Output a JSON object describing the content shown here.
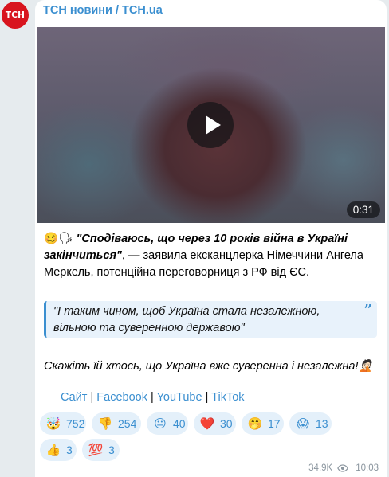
{
  "channel": {
    "avatar_text": "ТСН",
    "name": "ТСН новини / TCH.ua"
  },
  "video": {
    "duration": "0:31",
    "play_icon": "play-icon"
  },
  "post": {
    "lead_emojis": "🥴🗣",
    "quote_headline": "\"Сподіваюсь, що через 10 років війна в Україні закінчиться\"",
    "lead_rest": ", — заявила ексканцлерка Німеччини Ангела Меркель, потенційна переговорниця з РФ від ЄС.",
    "blockquote": "\"І таким чином, щоб Україна стала незалежною, вільною та суверенною державою\"",
    "closing": "Скажіть їй хтось, що Україна вже суверенна і незалежна!",
    "closing_emoji": "🤦🏻"
  },
  "links": {
    "site": "Сайт",
    "facebook": "Facebook",
    "youtube": "YouTube",
    "tiktok": "TikTok",
    "separator": "|"
  },
  "reactions": [
    {
      "emoji": "🤯",
      "count": "752"
    },
    {
      "emoji": "👎",
      "count": "254"
    },
    {
      "emoji": "😐",
      "count": "40"
    },
    {
      "emoji": "❤️",
      "count": "30"
    },
    {
      "emoji": "🤭",
      "count": "17"
    },
    {
      "emoji": "😱",
      "count": "13"
    },
    {
      "emoji": "👍",
      "count": "3"
    },
    {
      "emoji": "💯",
      "count": "3"
    }
  ],
  "meta": {
    "views": "34.9K",
    "time": "10:03"
  },
  "colors": {
    "accent": "#3b8fd0",
    "brand": "#d8141e",
    "background": "#e6ebee",
    "reaction_bg": "#e4f0fa"
  }
}
